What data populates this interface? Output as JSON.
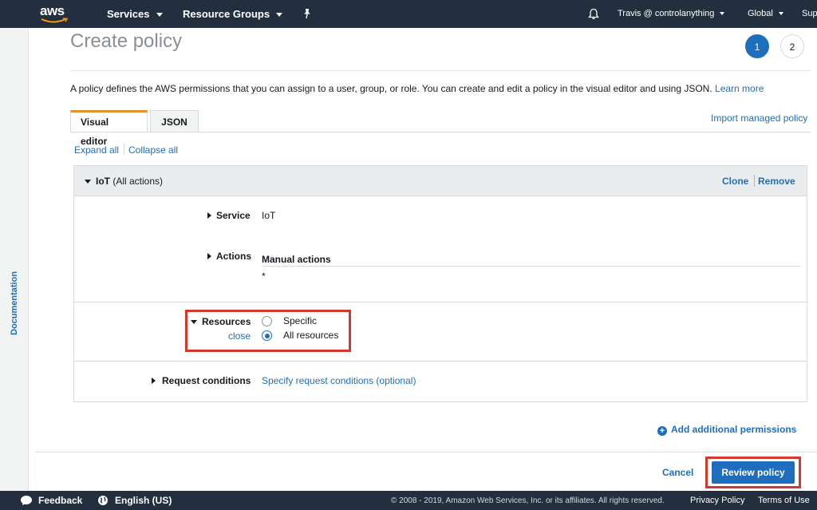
{
  "topnav": {
    "logo": "aws",
    "services": "Services",
    "resource_groups": "Resource Groups",
    "user": "Travis @ controlanything",
    "region": "Global",
    "support": "Sup"
  },
  "sidebar": {
    "documentation": "Documentation"
  },
  "header": {
    "title": "Create policy",
    "steps": [
      "1",
      "2"
    ],
    "intro": "A policy defines the AWS permissions that you can assign to a user, group, or role. You can create and edit a policy in the visual editor and using JSON.",
    "learn_more": "Learn more"
  },
  "tabs": {
    "visual_editor": "Visual editor",
    "json": "JSON",
    "import": "Import managed policy",
    "expand_all": "Expand all",
    "collapse_all": "Collapse all"
  },
  "policy": {
    "service_name": "IoT",
    "service_scope": "(All actions)",
    "clone": "Clone",
    "remove": "Remove",
    "service_label": "Service",
    "service_value": "IoT",
    "actions_label": "Actions",
    "actions_value": "Manual actions",
    "actions_star": "*",
    "resources_label": "Resources",
    "resources_close": "close",
    "resources_options": [
      {
        "label": "Specific",
        "checked": false
      },
      {
        "label": "All resources",
        "checked": true
      }
    ],
    "request_label": "Request conditions",
    "request_link": "Specify request conditions (optional)"
  },
  "add_permissions": "Add additional permissions",
  "actions": {
    "cancel": "Cancel",
    "review": "Review policy"
  },
  "footer": {
    "feedback": "Feedback",
    "language": "English (US)",
    "copyright": "© 2008 - 2019, Amazon Web Services, Inc. or its affiliates. All rights reserved.",
    "privacy": "Privacy Policy",
    "terms": "Terms of Use"
  },
  "colors": {
    "accent": "#1f6ebd",
    "nav_bg": "#232f3e",
    "highlight": "#d0392b",
    "tab_active": "#e58f34"
  }
}
